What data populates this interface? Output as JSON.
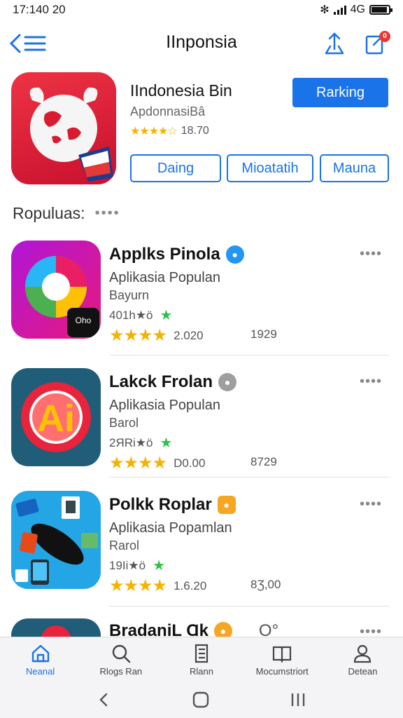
{
  "status_bar": {
    "time": "17:140  20",
    "network": "4G"
  },
  "header": {
    "title": "IInponsia",
    "notification_count": "0"
  },
  "featured": {
    "name": "IIndonesia Bin",
    "developer": "ApdonnasiBâ",
    "stars": "★★★★☆",
    "rating_text": "18.70",
    "primary_button": "Rarking",
    "buttons": [
      "Daing",
      "Mioatatih",
      "Mauna"
    ]
  },
  "section": {
    "title": "Ropuluas:",
    "more": "••••"
  },
  "apps": [
    {
      "name": "Applks Pinola",
      "subtitle": "Aplikasia Populan",
      "category": "Bayurn",
      "count": "401h★ö",
      "stars": "★★★★",
      "rating": "2.020",
      "size": "1929",
      "badge_color": "#2196f3"
    },
    {
      "name": "Lakck Frolan",
      "subtitle": "Aplikasia Populan",
      "category": "Barol",
      "count": "2ЯRi★ö",
      "stars": "★★★★",
      "rating": "D0.00",
      "size": "8729",
      "badge_color": "#9e9e9e"
    },
    {
      "name": "Polkk Roplar",
      "subtitle": "Aplikasia Popamlan",
      "category": "Rarol",
      "count": "19Ii★ö",
      "stars": "★★★★",
      "rating": "1.6.20",
      "size": "8Ʒ,00",
      "badge_color": "#f5a623"
    },
    {
      "name": "BradaniL Ɑk",
      "subtitle": "",
      "category": "",
      "count": "",
      "stars": "",
      "rating": "",
      "size": "",
      "badge_color": "#f5a623"
    }
  ],
  "tabs": [
    {
      "label": "Neanal",
      "icon": "home-icon"
    },
    {
      "label": "Rlogs Ran",
      "icon": "search-icon"
    },
    {
      "label": "Rlann",
      "icon": "list-icon"
    },
    {
      "label": "Mocumstriort",
      "icon": "book-icon"
    },
    {
      "label": "Detean",
      "icon": "person-icon"
    }
  ],
  "colors": {
    "accent": "#1a73e8",
    "star": "#f5b301",
    "green": "#2ec04a"
  }
}
